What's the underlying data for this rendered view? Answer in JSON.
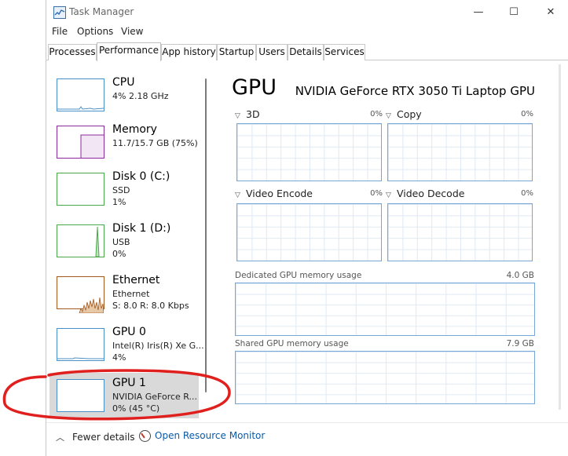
{
  "window": {
    "title": "Task Manager"
  },
  "menu": [
    "File",
    "Options",
    "View"
  ],
  "tabs": [
    "Processes",
    "Performance",
    "App history",
    "Startup",
    "Users",
    "Details",
    "Services"
  ],
  "sidebar": {
    "items": [
      {
        "title": "CPU",
        "sub": [
          "4%  2.18 GHz"
        ],
        "color": "#4a90c8"
      },
      {
        "title": "Memory",
        "sub": [
          "11.7/15.7 GB (75%)"
        ],
        "color": "#8b2a9c"
      },
      {
        "title": "Disk 0 (C:)",
        "sub": [
          "SSD",
          "1%"
        ],
        "color": "#4aa84a"
      },
      {
        "title": "Disk 1 (D:)",
        "sub": [
          "USB",
          "0%"
        ],
        "color": "#4aa84a"
      },
      {
        "title": "Ethernet",
        "sub": [
          "Ethernet",
          "S: 8.0  R: 8.0 Kbps"
        ],
        "color": "#a45a1e"
      },
      {
        "title": "GPU 0",
        "sub": [
          "Intel(R) Iris(R) Xe G...",
          "4%"
        ],
        "color": "#4a90c8"
      },
      {
        "title": "GPU 1",
        "sub": [
          "NVIDIA GeForce R...",
          "0% (45 °C)"
        ],
        "color": "#4a90c8"
      }
    ]
  },
  "main": {
    "title": "GPU",
    "model": "NVIDIA GeForce RTX 3050 Ti Laptop GPU",
    "engines": [
      {
        "label": "3D",
        "pct": "0%"
      },
      {
        "label": "Copy",
        "pct": "0%"
      },
      {
        "label": "Video Encode",
        "pct": "0%"
      },
      {
        "label": "Video Decode",
        "pct": "0%"
      }
    ],
    "dedicated": {
      "label": "Dedicated GPU memory usage",
      "max": "4.0 GB"
    },
    "shared": {
      "label": "Shared GPU memory usage",
      "max": "7.9 GB"
    }
  },
  "footer": {
    "fewer_details": "Fewer details",
    "open_monitor": "Open Resource Monitor"
  },
  "colors": {
    "accent": "#4a90c8",
    "annotation": "#e0201e"
  }
}
